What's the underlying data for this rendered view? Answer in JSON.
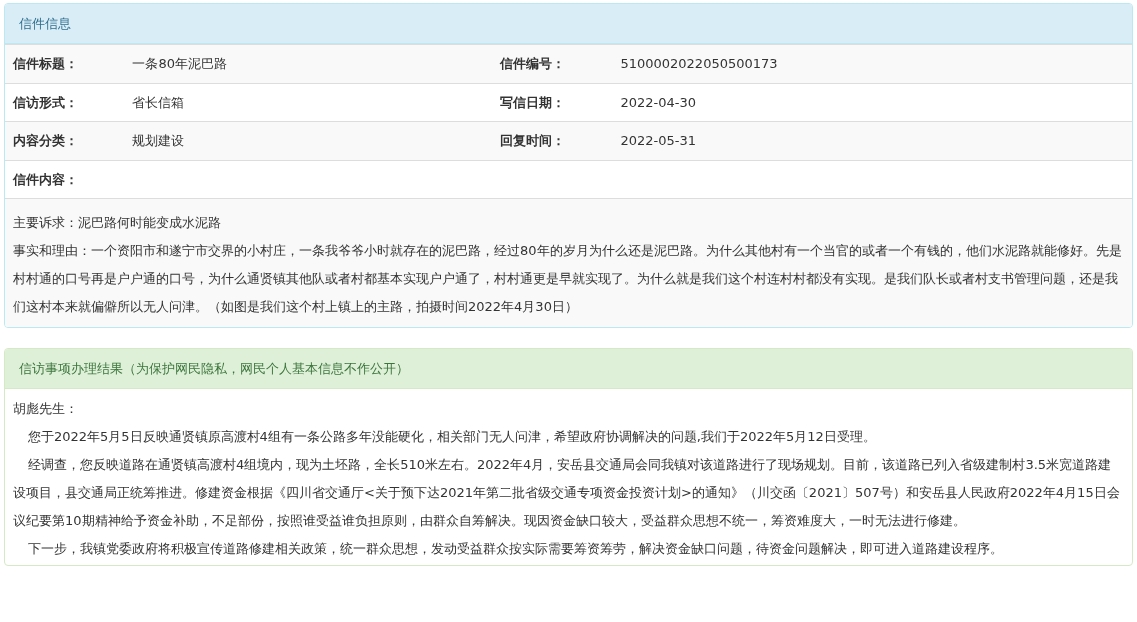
{
  "letter_info": {
    "title": "信件信息",
    "rows": [
      [
        {
          "label": "信件标题：",
          "value": "一条80年泥巴路"
        },
        {
          "label": "信件编号：",
          "value": "5100002022050500173"
        }
      ],
      [
        {
          "label": "信访形式：",
          "value": "省长信箱"
        },
        {
          "label": "写信日期：",
          "value": "2022-04-30"
        }
      ],
      [
        {
          "label": "内容分类：",
          "value": "规划建设"
        },
        {
          "label": "回复时间：",
          "value": "2022-05-31"
        }
      ],
      [
        {
          "label": "信件内容："
        }
      ]
    ],
    "content": [
      "主要诉求：泥巴路何时能变成水泥路",
      "事实和理由：一个资阳市和遂宁市交界的小村庄，一条我爷爷小时就存在的泥巴路，经过80年的岁月为什么还是泥巴路。为什么其他村有一个当官的或者一个有钱的，他们水泥路就能修好。先是村村通的口号再是户户通的口号，为什么通贤镇其他队或者村都基本实现户户通了，村村通更是早就实现了。为什么就是我们这个村连村村都没有实现。是我们队长或者村支书管理问题，还是我们这村本来就偏僻所以无人问津。（如图是我们这个村上镇上的主路，拍摄时间2022年4月30日）"
    ]
  },
  "result": {
    "title": "信访事项办理结果（为保护网民隐私，网民个人基本信息不作公开）",
    "salutation": "胡彪先生：",
    "paragraphs": [
      "您于2022年5月5日反映通贤镇原高渡村4组有一条公路多年没能硬化，相关部门无人问津，希望政府协调解决的问题,我们于2022年5月12日受理。",
      "经调查，您反映道路在通贤镇高渡村4组境内，现为土坯路，全长510米左右。2022年4月，安岳县交通局会同我镇对该道路进行了现场规划。目前，该道路已列入省级建制村3.5米宽道路建设项目，县交通局正统筹推进。修建资金根据《四川省交通厅<关于预下达2021年第二批省级交通专项资金投资计划>的通知》（川交函〔2021〕507号）和安岳县人民政府2022年4月15日会议纪要第10期精神给予资金补助，不足部份，按照谁受益谁负担原则，由群众自筹解决。现因资金缺口较大，受益群众思想不统一，筹资难度大，一时无法进行修建。",
      "下一步，我镇党委政府将积极宣传道路修建相关政策，统一群众思想，发动受益群众按实际需要筹资筹劳，解决资金缺口问题，待资金问题解决，即可进入道路建设程序。"
    ]
  }
}
